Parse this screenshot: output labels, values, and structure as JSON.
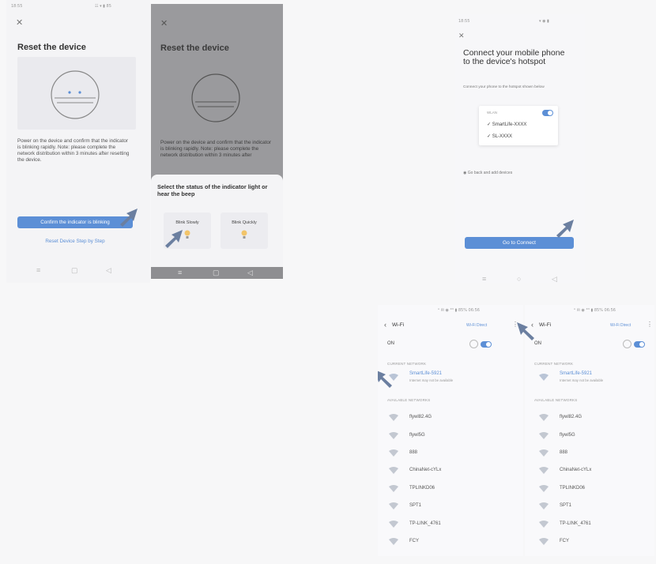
{
  "reset": {
    "status_time": "18:55",
    "status_icons": "☷ ▾ ▮ 85",
    "title": "Reset the device",
    "desc": "Power on the device and confirm that the indicator is blinking rapidly. Note: please complete the network distribution within 3 minutes after resetting the device.",
    "confirm_button": "Confirm the indicator is blinking",
    "reset_link": "Reset Device Step by Step"
  },
  "reset_overlay": {
    "title": "Reset the device",
    "desc": "Power on the device and confirm that the indicator is blinking rapidly. Note: please complete the network distribution within 3 minutes after",
    "sheet_title": "Select the status of the indicator light or hear the beep",
    "option_slow": "Blink Slowly",
    "option_quick": "Blink Quickly"
  },
  "hotspot": {
    "status_time": "18:55",
    "title": "Connect your mobile phone to the device's hotspot",
    "instruction": "Connect your phone to the hotspot shown below",
    "wlan_label": "WLAN",
    "networks": [
      "SmartLife-XXXX",
      "SL-XXXX"
    ],
    "go_back": "Go back and add devices",
    "connect_button": "Go to Connect"
  },
  "wifi_left": {
    "status": "ᴬ ✉ ◉ ⁴ᴳ ▮ 85% 06:56",
    "title": "Wi-Fi",
    "direct": "Wi-Fi Direct",
    "on_label": "ON",
    "current_header": "CURRENT NETWORK",
    "current_name": "SmartLife-5921",
    "current_sub": "Internet may not be available",
    "available_header": "AVAILABLE NETWORKS",
    "networks": [
      "flywl82.4G",
      "flywl5G",
      "888",
      "ChinaNet-cYLx",
      "TPLINKD06",
      "SPT1",
      "TP-LINK_4761",
      "FCY"
    ]
  },
  "wifi_right": {
    "status": "ᴬ ✉ ◉ ⁴ᴳ ▮ 85% 06:56",
    "title": "Wi-Fi",
    "direct": "Wi-Fi Direct",
    "on_label": "ON",
    "current_header": "CURRENT NETWORK",
    "current_name": "SmartLife-5921",
    "current_sub": "Internet may not be available",
    "available_header": "AVAILABLE NETWORKS",
    "networks": [
      "flywl82.4G",
      "flywl5G",
      "888",
      "ChinaNet-cYLx",
      "TPLINKD06",
      "SPT1",
      "TP-LINK_4761",
      "FCY"
    ]
  },
  "colors": {
    "accent": "#5c8fd6",
    "arrow": "#6b7fa0",
    "overlay": "#9a9a9d"
  },
  "icons": {
    "arrow": "pointer-arrow-icon",
    "wifi": "wifi-icon",
    "bulb": "bulb-icon"
  }
}
